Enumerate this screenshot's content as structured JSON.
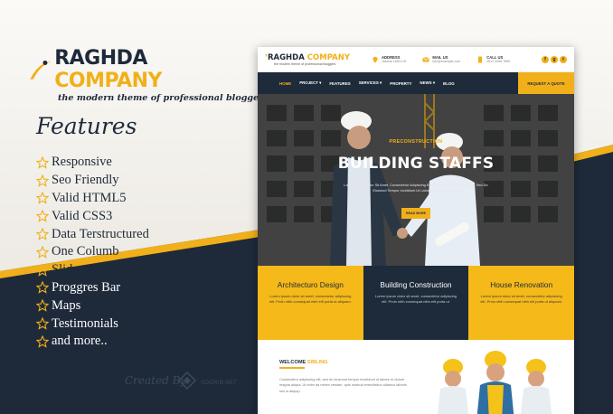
{
  "brand": {
    "name_part1": "RAGHDA",
    "name_part2": "COMPANY",
    "tagline": "the modern theme of professional bloggers"
  },
  "features": {
    "title": "Features",
    "items": [
      "Responsive",
      "Seo Friendly",
      "Valid HTML5",
      "Valid CSS3",
      "Data Terstructured",
      "One Columb",
      "Slider Slide",
      "Proggres Bar",
      "Maps",
      "Testimonials",
      "and more.."
    ]
  },
  "credit": {
    "label": "Created By",
    "author": "SOORIB.NET"
  },
  "mockup": {
    "logo": {
      "part1": "RAGHDA",
      "part2": "COMPANY",
      "tagline": "the modern theme of professional bloggers"
    },
    "info": [
      {
        "label": "ADDRESS",
        "value": "Jakarta 16515 ID"
      },
      {
        "label": "MAIL US",
        "value": "info@example.com"
      },
      {
        "label": "CALL US",
        "value": "0812 3456 7890"
      }
    ],
    "social": [
      "f",
      "g",
      "t"
    ],
    "nav": [
      "HOME",
      "PROJECT ▾",
      "FEATURES",
      "SERVICES ▾",
      "PROPERTY",
      "NEWS ▾",
      "BLOG"
    ],
    "quote_button": "REQUEST A QUOTE",
    "hero": {
      "subtitle": "PRECONSTRUCTION",
      "title": "BUILDING STAFFS",
      "text": "Lorem Ipsum Dolor Sit Amet, Consectetur Adipiscing Elit Consectetur Adipiscing Elit, Sed Do Eiusmod Tempor Incididunt Ut Labore Et Dolore Magna",
      "button": "READ MORE"
    },
    "services": [
      {
        "title": "Architecturo Design",
        "text": "Lorem ipsum dolor sit amet, consectetur adipiscing elit. Proin nibh consequat nibh elit porta ut aliquam."
      },
      {
        "title": "Building Construction",
        "text": "Lorem ipsum dolor sit amet, consectetur adipiscing elit. Proin nibh consequat nibh elit porta ut."
      },
      {
        "title": "House Renovation",
        "text": "Lorem ipsum dolor sit amet, consectetur adipiscing elit. Proin nibh consequat nibh elit porta ut aliquam."
      }
    ],
    "welcome": {
      "title_part1": "WELCOME",
      "title_part2": "SIBLING",
      "text": "Consectetur adipiscing elit, sed do eiusmod tempor incididunt ut labore et dolore magna aliqua. Ut enim ad minim veniam, quis nostrud exercitation ullamco laboris nisi ut aliquip."
    }
  },
  "colors": {
    "accent": "#f1b01a",
    "navy": "#1d2b3a",
    "yellow_panel": "#f5b919"
  }
}
